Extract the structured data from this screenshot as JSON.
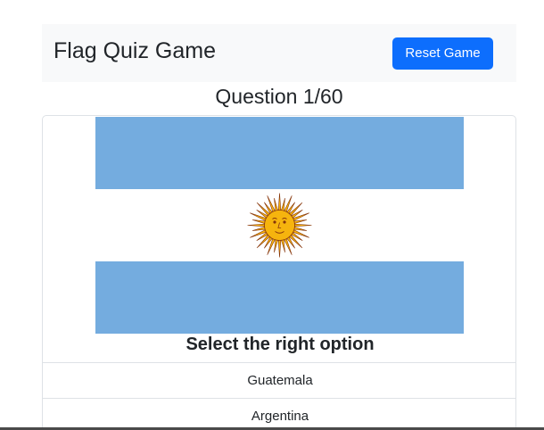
{
  "navbar": {
    "brand": "Flag Quiz Game",
    "reset_label": "Reset Game"
  },
  "quiz": {
    "question_counter": "Question 1/60",
    "flag_icon": "argentina-flag",
    "prompt": "Select the right option",
    "options": [
      {
        "label": "Guatemala"
      },
      {
        "label": "Argentina"
      }
    ]
  },
  "colors": {
    "accent": "#0d6efd",
    "flag_blue": "#74acdf",
    "sun": "#f6b40e"
  }
}
